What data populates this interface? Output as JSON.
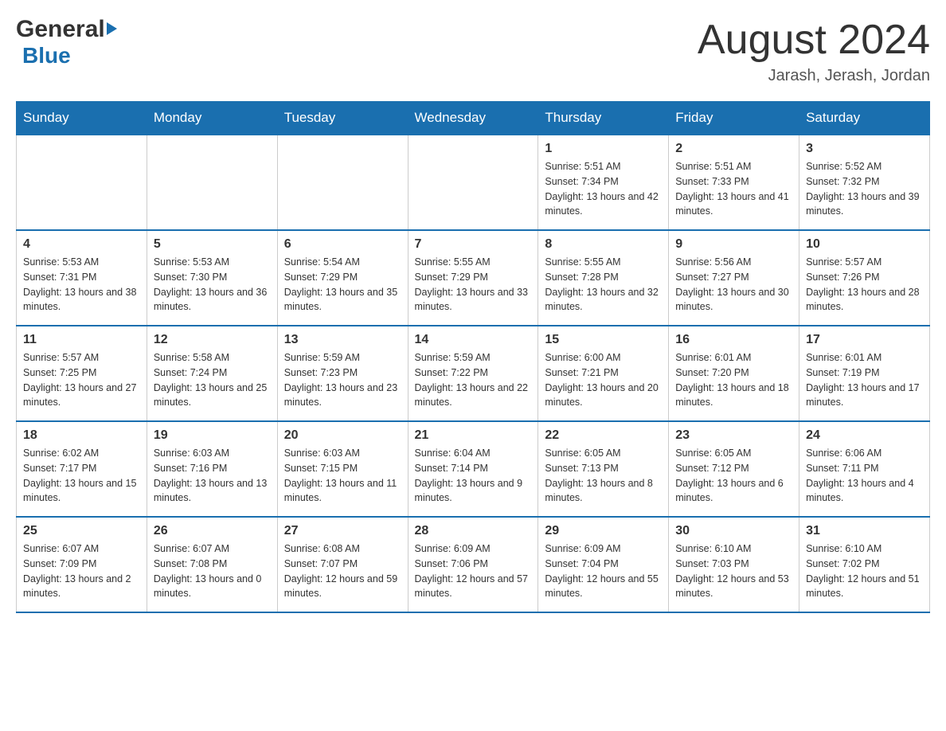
{
  "header": {
    "logo_general": "General",
    "logo_blue": "Blue",
    "month_title": "August 2024",
    "location": "Jarash, Jerash, Jordan"
  },
  "days_of_week": [
    "Sunday",
    "Monday",
    "Tuesday",
    "Wednesday",
    "Thursday",
    "Friday",
    "Saturday"
  ],
  "weeks": [
    [
      {
        "day": "",
        "sunrise": "",
        "sunset": "",
        "daylight": ""
      },
      {
        "day": "",
        "sunrise": "",
        "sunset": "",
        "daylight": ""
      },
      {
        "day": "",
        "sunrise": "",
        "sunset": "",
        "daylight": ""
      },
      {
        "day": "",
        "sunrise": "",
        "sunset": "",
        "daylight": ""
      },
      {
        "day": "1",
        "sunrise": "Sunrise: 5:51 AM",
        "sunset": "Sunset: 7:34 PM",
        "daylight": "Daylight: 13 hours and 42 minutes."
      },
      {
        "day": "2",
        "sunrise": "Sunrise: 5:51 AM",
        "sunset": "Sunset: 7:33 PM",
        "daylight": "Daylight: 13 hours and 41 minutes."
      },
      {
        "day": "3",
        "sunrise": "Sunrise: 5:52 AM",
        "sunset": "Sunset: 7:32 PM",
        "daylight": "Daylight: 13 hours and 39 minutes."
      }
    ],
    [
      {
        "day": "4",
        "sunrise": "Sunrise: 5:53 AM",
        "sunset": "Sunset: 7:31 PM",
        "daylight": "Daylight: 13 hours and 38 minutes."
      },
      {
        "day": "5",
        "sunrise": "Sunrise: 5:53 AM",
        "sunset": "Sunset: 7:30 PM",
        "daylight": "Daylight: 13 hours and 36 minutes."
      },
      {
        "day": "6",
        "sunrise": "Sunrise: 5:54 AM",
        "sunset": "Sunset: 7:29 PM",
        "daylight": "Daylight: 13 hours and 35 minutes."
      },
      {
        "day": "7",
        "sunrise": "Sunrise: 5:55 AM",
        "sunset": "Sunset: 7:29 PM",
        "daylight": "Daylight: 13 hours and 33 minutes."
      },
      {
        "day": "8",
        "sunrise": "Sunrise: 5:55 AM",
        "sunset": "Sunset: 7:28 PM",
        "daylight": "Daylight: 13 hours and 32 minutes."
      },
      {
        "day": "9",
        "sunrise": "Sunrise: 5:56 AM",
        "sunset": "Sunset: 7:27 PM",
        "daylight": "Daylight: 13 hours and 30 minutes."
      },
      {
        "day": "10",
        "sunrise": "Sunrise: 5:57 AM",
        "sunset": "Sunset: 7:26 PM",
        "daylight": "Daylight: 13 hours and 28 minutes."
      }
    ],
    [
      {
        "day": "11",
        "sunrise": "Sunrise: 5:57 AM",
        "sunset": "Sunset: 7:25 PM",
        "daylight": "Daylight: 13 hours and 27 minutes."
      },
      {
        "day": "12",
        "sunrise": "Sunrise: 5:58 AM",
        "sunset": "Sunset: 7:24 PM",
        "daylight": "Daylight: 13 hours and 25 minutes."
      },
      {
        "day": "13",
        "sunrise": "Sunrise: 5:59 AM",
        "sunset": "Sunset: 7:23 PM",
        "daylight": "Daylight: 13 hours and 23 minutes."
      },
      {
        "day": "14",
        "sunrise": "Sunrise: 5:59 AM",
        "sunset": "Sunset: 7:22 PM",
        "daylight": "Daylight: 13 hours and 22 minutes."
      },
      {
        "day": "15",
        "sunrise": "Sunrise: 6:00 AM",
        "sunset": "Sunset: 7:21 PM",
        "daylight": "Daylight: 13 hours and 20 minutes."
      },
      {
        "day": "16",
        "sunrise": "Sunrise: 6:01 AM",
        "sunset": "Sunset: 7:20 PM",
        "daylight": "Daylight: 13 hours and 18 minutes."
      },
      {
        "day": "17",
        "sunrise": "Sunrise: 6:01 AM",
        "sunset": "Sunset: 7:19 PM",
        "daylight": "Daylight: 13 hours and 17 minutes."
      }
    ],
    [
      {
        "day": "18",
        "sunrise": "Sunrise: 6:02 AM",
        "sunset": "Sunset: 7:17 PM",
        "daylight": "Daylight: 13 hours and 15 minutes."
      },
      {
        "day": "19",
        "sunrise": "Sunrise: 6:03 AM",
        "sunset": "Sunset: 7:16 PM",
        "daylight": "Daylight: 13 hours and 13 minutes."
      },
      {
        "day": "20",
        "sunrise": "Sunrise: 6:03 AM",
        "sunset": "Sunset: 7:15 PM",
        "daylight": "Daylight: 13 hours and 11 minutes."
      },
      {
        "day": "21",
        "sunrise": "Sunrise: 6:04 AM",
        "sunset": "Sunset: 7:14 PM",
        "daylight": "Daylight: 13 hours and 9 minutes."
      },
      {
        "day": "22",
        "sunrise": "Sunrise: 6:05 AM",
        "sunset": "Sunset: 7:13 PM",
        "daylight": "Daylight: 13 hours and 8 minutes."
      },
      {
        "day": "23",
        "sunrise": "Sunrise: 6:05 AM",
        "sunset": "Sunset: 7:12 PM",
        "daylight": "Daylight: 13 hours and 6 minutes."
      },
      {
        "day": "24",
        "sunrise": "Sunrise: 6:06 AM",
        "sunset": "Sunset: 7:11 PM",
        "daylight": "Daylight: 13 hours and 4 minutes."
      }
    ],
    [
      {
        "day": "25",
        "sunrise": "Sunrise: 6:07 AM",
        "sunset": "Sunset: 7:09 PM",
        "daylight": "Daylight: 13 hours and 2 minutes."
      },
      {
        "day": "26",
        "sunrise": "Sunrise: 6:07 AM",
        "sunset": "Sunset: 7:08 PM",
        "daylight": "Daylight: 13 hours and 0 minutes."
      },
      {
        "day": "27",
        "sunrise": "Sunrise: 6:08 AM",
        "sunset": "Sunset: 7:07 PM",
        "daylight": "Daylight: 12 hours and 59 minutes."
      },
      {
        "day": "28",
        "sunrise": "Sunrise: 6:09 AM",
        "sunset": "Sunset: 7:06 PM",
        "daylight": "Daylight: 12 hours and 57 minutes."
      },
      {
        "day": "29",
        "sunrise": "Sunrise: 6:09 AM",
        "sunset": "Sunset: 7:04 PM",
        "daylight": "Daylight: 12 hours and 55 minutes."
      },
      {
        "day": "30",
        "sunrise": "Sunrise: 6:10 AM",
        "sunset": "Sunset: 7:03 PM",
        "daylight": "Daylight: 12 hours and 53 minutes."
      },
      {
        "day": "31",
        "sunrise": "Sunrise: 6:10 AM",
        "sunset": "Sunset: 7:02 PM",
        "daylight": "Daylight: 12 hours and 51 minutes."
      }
    ]
  ]
}
